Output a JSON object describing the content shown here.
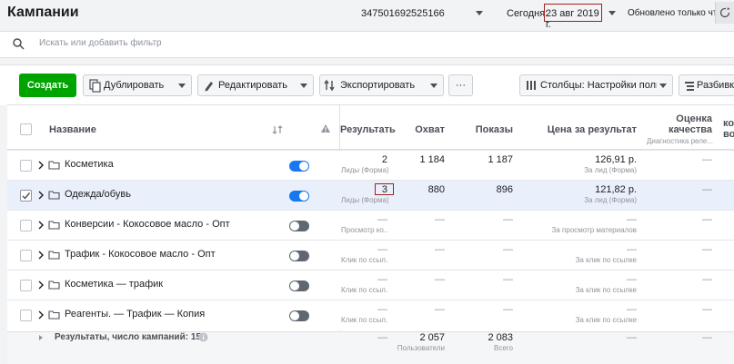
{
  "header": {
    "title": "Кампании",
    "account_id": "347501692525166",
    "today_label": "Сегодня:",
    "date": "23 авг 2019 г.",
    "updated": "Обновлено только что"
  },
  "search": {
    "placeholder": "Искать или добавить фильтр"
  },
  "toolbar": {
    "create": "Создать",
    "duplicate": "Дублировать",
    "edit": "Редактировать",
    "export": "Экспортировать",
    "more": "···",
    "columns": "Столбцы: Настройки поль:",
    "breakdown": "Разбивк"
  },
  "columns": {
    "name": "Название",
    "result": "Результать",
    "reach": "Охват",
    "impressions": "Показы",
    "cost": "Цена за результат",
    "quality": "Оценка качества",
    "quality_sub": "Диагностика реле...",
    "extra": "ко во"
  },
  "rows": [
    {
      "name": "Косметика",
      "on": true,
      "result": "2",
      "result_sub": "Лиды (Форма)",
      "reach": "1 184",
      "impressions": "1 187",
      "cost": "126,91 р.",
      "cost_sub": "За лид (Форма)",
      "quality": "—"
    },
    {
      "name": "Одежда/обувь",
      "on": true,
      "selected": true,
      "result": "3",
      "result_sub": "Лиды (Форма)",
      "reach": "880",
      "impressions": "896",
      "cost": "121,82 р.",
      "cost_sub": "За лид (Форма)",
      "quality": "—"
    },
    {
      "name": "Конверсии - Кокосовое масло - Опт",
      "on": false,
      "result": "—",
      "result_sub": "Просмотр ко...",
      "reach": "—",
      "impressions": "—",
      "cost": "—",
      "cost_sub": "За просмотр материалов",
      "quality": "—"
    },
    {
      "name": "Трафик - Кокосовое масло - Опт",
      "on": false,
      "result": "—",
      "result_sub": "Клик по ссыл...",
      "reach": "—",
      "impressions": "—",
      "cost": "—",
      "cost_sub": "За клик по ссылке",
      "quality": "—"
    },
    {
      "name": "Косметика — трафик",
      "on": false,
      "result": "—",
      "result_sub": "Клик по ссыл...",
      "reach": "—",
      "impressions": "—",
      "cost": "—",
      "cost_sub": "За клик по ссылке",
      "quality": "—"
    },
    {
      "name": "Реагенты. — Трафик — Копия",
      "on": false,
      "result": "—",
      "result_sub": "Клик по ссыл...",
      "reach": "—",
      "impressions": "—",
      "cost": "—",
      "cost_sub": "За клик по ссылке",
      "quality": "—"
    }
  ],
  "footer": {
    "label": "Результаты, число кампаний: 15",
    "result": "—",
    "reach": "2 057",
    "reach_sub": "Пользователи",
    "impressions": "2 083",
    "impressions_sub": "Всего",
    "cost": "—",
    "quality": "—"
  },
  "colors": {
    "create_button": "#00a400",
    "toggle_on": "#1877f2",
    "highlight_box": "#a02020"
  }
}
